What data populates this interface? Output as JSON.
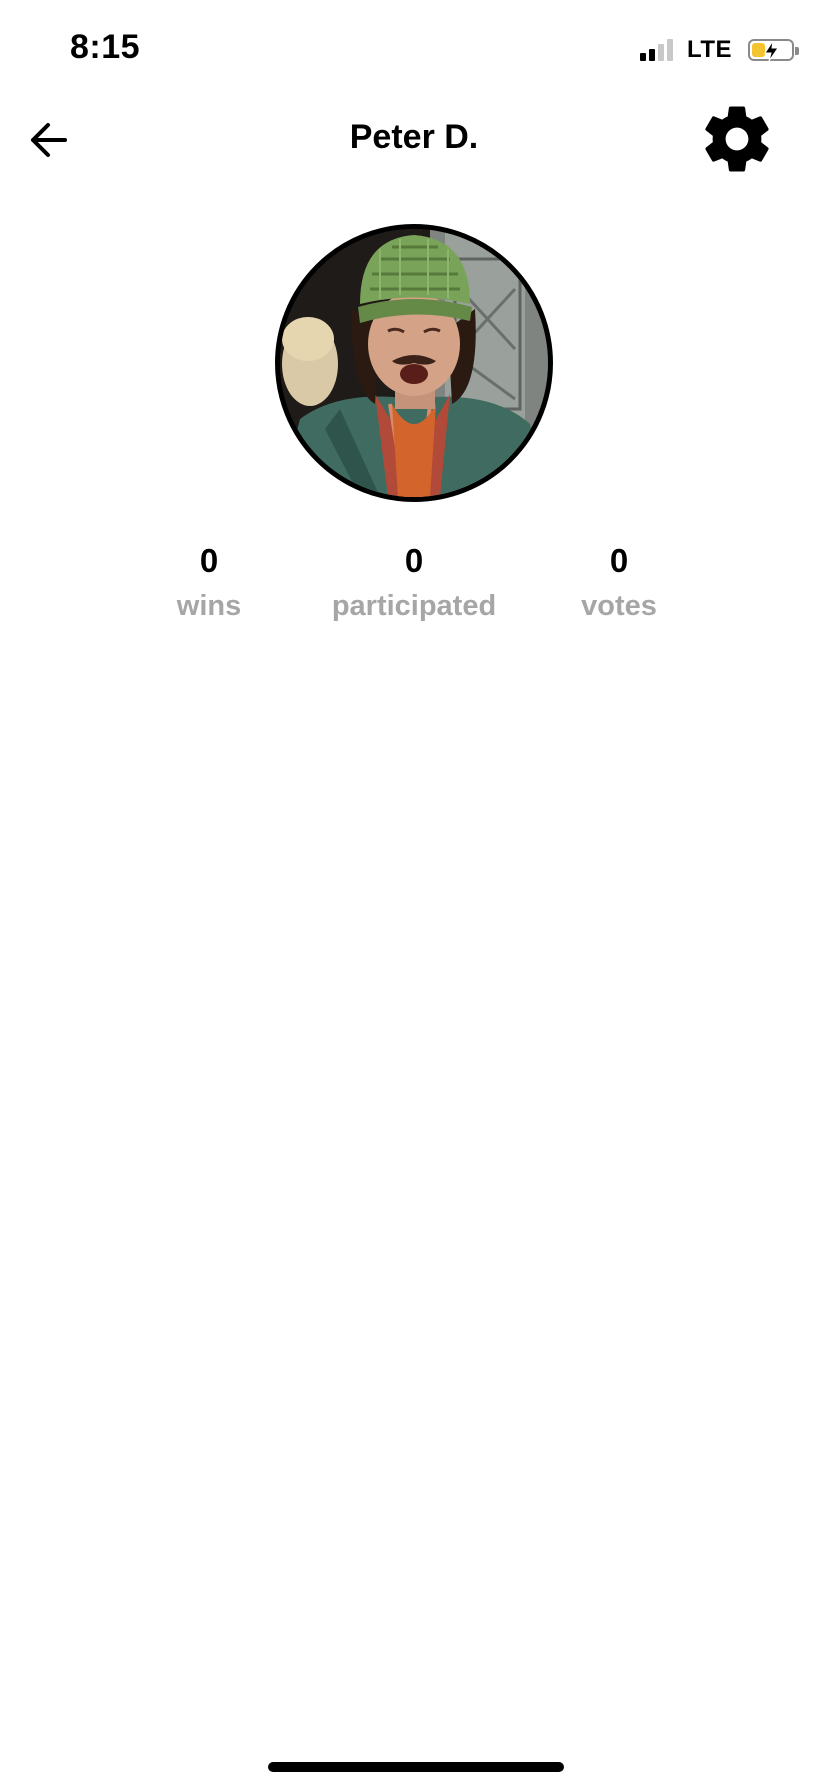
{
  "status_bar": {
    "time": "8:15",
    "network": "LTE",
    "signal_bars_active": 2,
    "signal_bars_total": 4,
    "battery_level": 0.35,
    "battery_charging": true,
    "battery_color": "#f4c430"
  },
  "header": {
    "title": "Peter D.",
    "back_icon": "arrow-left-icon",
    "settings_icon": "gear-icon"
  },
  "profile": {
    "avatar_alt": "profile photo"
  },
  "stats": {
    "wins": {
      "value": "0",
      "label": "wins"
    },
    "participated": {
      "value": "0",
      "label": "participated"
    },
    "votes": {
      "value": "0",
      "label": "votes"
    }
  },
  "colors": {
    "label_gray": "#a6a6a6",
    "text": "#000000",
    "background": "#ffffff"
  }
}
